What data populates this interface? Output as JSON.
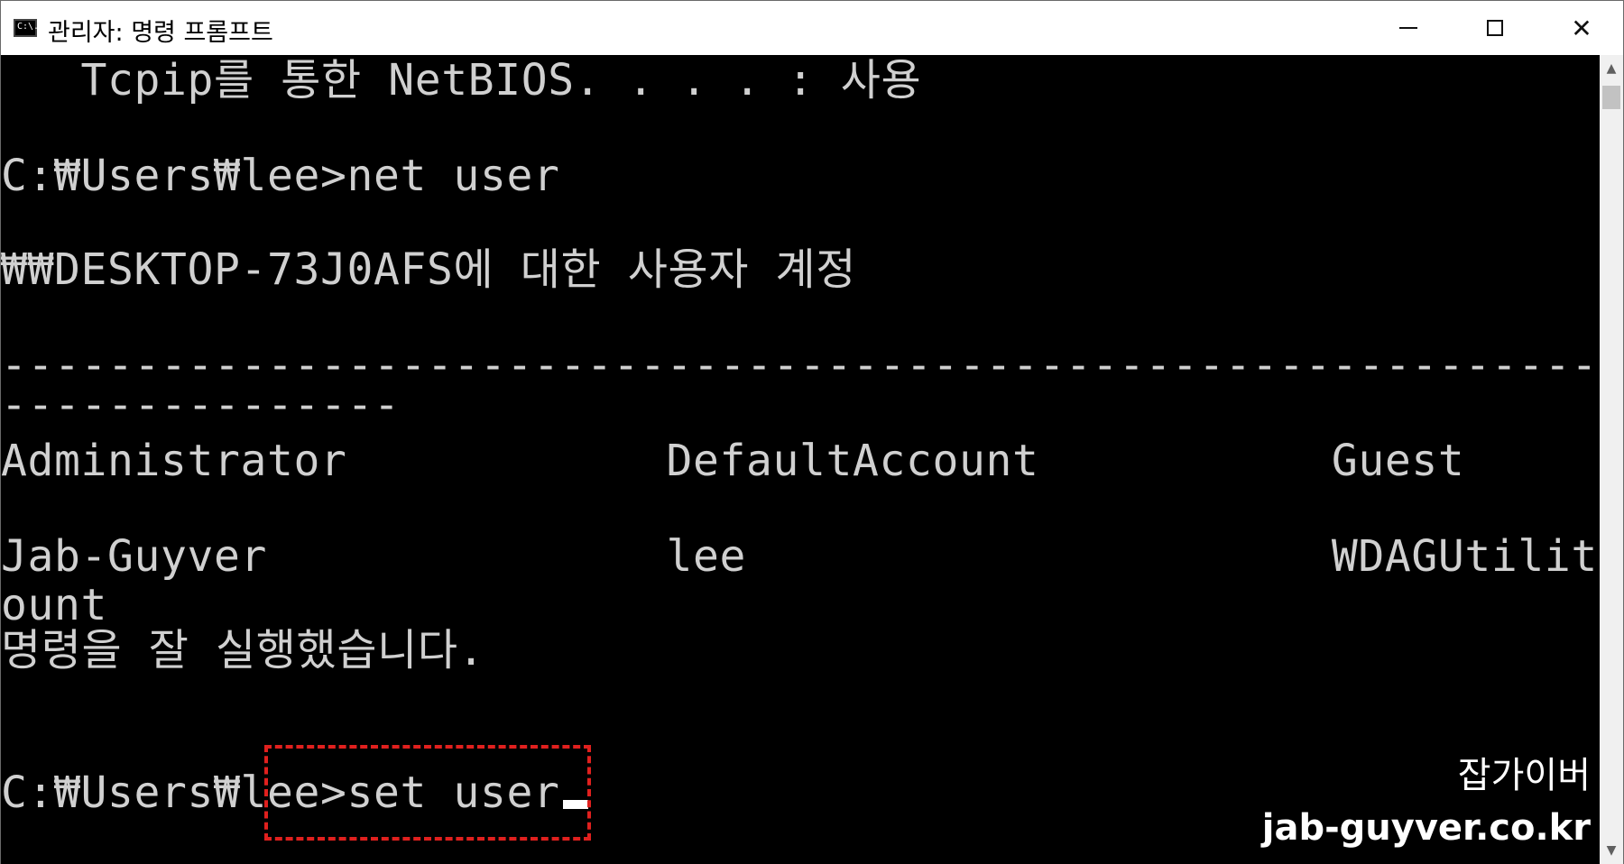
{
  "window": {
    "title": "관리자: 명령 프롬프트",
    "icon_label": "C:\\."
  },
  "console": {
    "lines": [
      "   Tcpip를 통한 NetBIOS. . . . : 사용",
      "",
      "C:₩Users₩lee>net user",
      "",
      "₩₩DESKTOP-73J0AFS에 대한 사용자 계정",
      "",
      "-------------------------------------------------------------------------------",
      "---------------",
      "Administrator            DefaultAccount           Guest",
      "",
      "Jab-Guyver               lee                      WDAGUtilityAcc",
      "ount",
      "명령을 잘 실행했습니다.",
      "",
      "",
      "C:₩Users₩lee>set user"
    ]
  },
  "watermark": {
    "name": "잡가이버",
    "url": "jab-guyver.co.kr"
  },
  "icons": {
    "minimize": "minimize-icon",
    "maximize": "maximize-icon",
    "close": "close-icon"
  },
  "colors": {
    "console_bg": "#000000",
    "console_text": "#d0d0d0",
    "highlight": "#e0201e"
  }
}
